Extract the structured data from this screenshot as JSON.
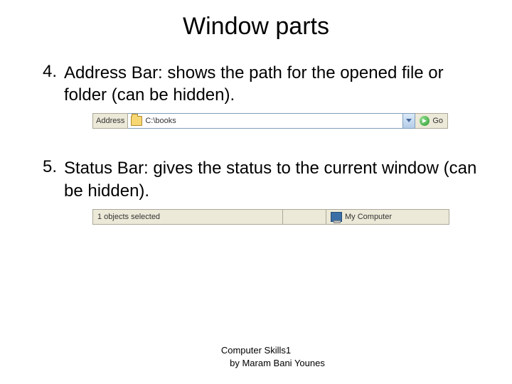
{
  "title": "Window parts",
  "items": [
    {
      "num": "4.",
      "text": "Address Bar: shows the path for the opened file or folder (can be hidden)."
    },
    {
      "num": "5.",
      "text": "Status Bar: gives the status to the current window (can be hidden)."
    }
  ],
  "addressbar": {
    "label": "Address",
    "path": "C:\\books",
    "go": "Go"
  },
  "statusbar": {
    "left": "1 objects selected",
    "right": "My Computer"
  },
  "footer": {
    "line1": "Computer Skills1",
    "line2": "by Maram Bani Younes"
  }
}
